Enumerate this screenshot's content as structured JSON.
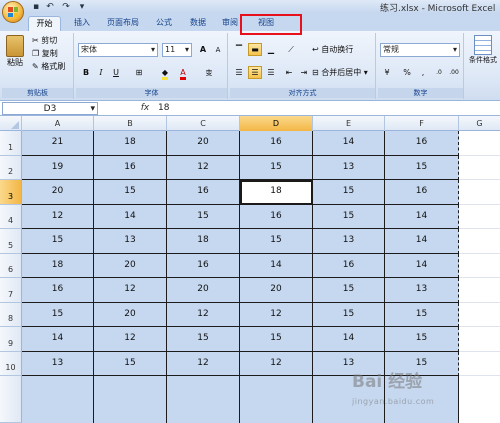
{
  "window": {
    "title": "练习.xlsx - Microsoft Excel"
  },
  "tabs": [
    "开始",
    "插入",
    "页面布局",
    "公式",
    "数据",
    "审阅",
    "视图"
  ],
  "ribbon": {
    "clipboard": {
      "paste": "粘贴",
      "cut": "剪切",
      "copy": "复制",
      "format_painter": "格式刷",
      "label": "剪贴板"
    },
    "font": {
      "name": "宋体",
      "size": "11",
      "grow": "A",
      "shrink": "A",
      "bold": "B",
      "italic": "I",
      "underline": "U",
      "font_color_glyph": "A",
      "phonetic": "变",
      "label": "字体"
    },
    "alignment": {
      "wrap": "自动换行",
      "merge": "合并后居中",
      "label": "对齐方式"
    },
    "number": {
      "format": "常规",
      "percent": "%",
      "comma": ",",
      "inc_decimal": ".0→.00",
      "dec_decimal": ".00→.0",
      "label": "数字"
    },
    "styles": {
      "conditional": "条件格式"
    }
  },
  "formula_bar": {
    "name_box": "D3",
    "fx": "fx",
    "value": "18"
  },
  "grid": {
    "columns": [
      "A",
      "B",
      "C",
      "D",
      "E",
      "F",
      "G"
    ],
    "rows": [
      "1",
      "2",
      "3",
      "4",
      "5",
      "6",
      "7",
      "8",
      "9",
      "10"
    ],
    "data": [
      [
        "21",
        "18",
        "20",
        "16",
        "14",
        "16"
      ],
      [
        "19",
        "16",
        "12",
        "15",
        "13",
        "15"
      ],
      [
        "20",
        "15",
        "16",
        "18",
        "15",
        "16"
      ],
      [
        "12",
        "14",
        "15",
        "16",
        "15",
        "14"
      ],
      [
        "15",
        "13",
        "18",
        "15",
        "13",
        "14"
      ],
      [
        "18",
        "20",
        "16",
        "14",
        "16",
        "14"
      ],
      [
        "16",
        "12",
        "20",
        "20",
        "15",
        "13"
      ],
      [
        "15",
        "20",
        "12",
        "12",
        "15",
        "15"
      ],
      [
        "14",
        "12",
        "15",
        "15",
        "14",
        "15"
      ],
      [
        "13",
        "15",
        "12",
        "12",
        "13",
        "15"
      ]
    ],
    "active_cell": "D3"
  },
  "watermark": {
    "text": "Bai 经验",
    "url": "jingyan.baidu.com"
  }
}
